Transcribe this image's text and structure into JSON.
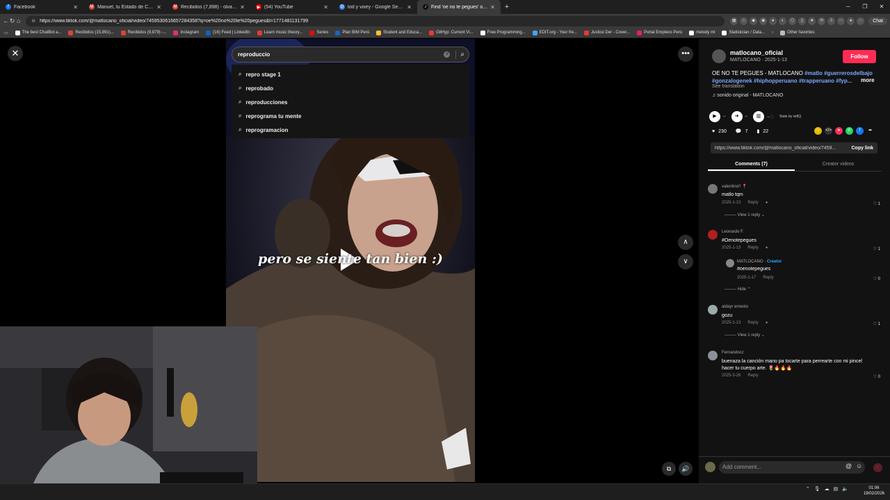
{
  "browser": {
    "tabs": [
      {
        "label": "Facebook",
        "color": "#1877f2",
        "glyph": "f"
      },
      {
        "label": "Manuel, tu Estado de Cuenta ya está",
        "color": "#db4437",
        "glyph": "M"
      },
      {
        "label": "Recibidos (7,898) - olvan.mu@gm",
        "color": "#db4437",
        "glyph": "M"
      },
      {
        "label": "(54) YouTube",
        "color": "#ff0000",
        "glyph": "▶"
      },
      {
        "label": "tod y vixey - Google Search",
        "color": "#4285f4",
        "glyph": "G"
      },
      {
        "label": "Find 'oe no te pegues' on TikTok",
        "color": "#111111",
        "glyph": "♪"
      }
    ],
    "url": "https://www.tiktok.com/@matlocano_oficial/video/7459530616657284358?q=oe%20no%20te%20pegues&t=1771481131799",
    "chat_label": "Chat",
    "bookmarks": [
      {
        "label": "The best ChatBot a...",
        "color": "#ffffff"
      },
      {
        "label": "Recibidos (15,891)...",
        "color": "#db4437"
      },
      {
        "label": "Recibidos (9,879) -...",
        "color": "#db4437"
      },
      {
        "label": "Instagram",
        "color": "#e1306c"
      },
      {
        "label": "(16) Feed | LinkedIn",
        "color": "#0a66c2"
      },
      {
        "label": "Learn music theory...",
        "color": "#e53935"
      },
      {
        "label": "Series",
        "color": "#e50914"
      },
      {
        "label": "Plan BIM Perú",
        "color": "#1565c0"
      },
      {
        "label": "Student and Educa...",
        "color": "#fbc02d"
      },
      {
        "label": "GitHyp: Current Vi...",
        "color": "#e53935"
      },
      {
        "label": "Free Programming...",
        "color": "#ffffff"
      },
      {
        "label": "EDIT.org - Your fre...",
        "color": "#42a5f5"
      },
      {
        "label": "Justice Der - Cover...",
        "color": "#e53935"
      },
      {
        "label": "Portal Empleos Perú",
        "color": "#e91e63"
      },
      {
        "label": "melody ml",
        "color": "#ffffff"
      },
      {
        "label": "Statistician / Data...",
        "color": "#ffffff"
      }
    ],
    "other_favorites": "Other favorites"
  },
  "search": {
    "query": "reproduccio",
    "suggestions": [
      "repro stage 1",
      "reprobado",
      "reproducciones",
      "reprograma tu mente",
      "reprogramacion"
    ]
  },
  "video": {
    "caption": "pero se siente tan bien :)"
  },
  "panel": {
    "username": "matlocano_oficial",
    "display_meta": "MATLOCANO · 2025-1-13",
    "follow_label": "Follow",
    "desc_text": "OE NO TE PEGUES - MATLOCANO",
    "hashtags": [
      "#matlo",
      "#guerrerosdelbajo",
      "#gonzalogenek",
      "#hiphopperuano",
      "#trapperuano",
      "#fyp..."
    ],
    "more_label": "more",
    "see_translation": "See translation",
    "sound": "sonido original - MATLOCANO",
    "stats_by": "Stats by vidIQ",
    "likes": "230",
    "comments": "7",
    "saves": "22",
    "link": "https://www.tiktok.com/@matlocano_oficial/video/7459...",
    "copy_link": "Copy link",
    "tab_comments": "Comments (7)",
    "tab_creator": "Creator videos",
    "comments_list": [
      {
        "user": "valentino!! 📍",
        "text": "matlo tqm",
        "date": "2025-1-13",
        "reply": "Reply",
        "likes": "1",
        "view": "View 1 reply"
      },
      {
        "user": "Leonardo F.",
        "text": "#Oenotepegues",
        "date": "2025-1-13",
        "reply": "Reply",
        "likes": "1"
      },
      {
        "user": "aldayr ernesto",
        "text": "gozu",
        "date": "2025-1-13",
        "reply": "Reply",
        "likes": "1",
        "view": "View 1 reply"
      },
      {
        "user": "Fernandocz",
        "text": "buenaza la canción mano pa tocarte para perrearte con mi pincel hacer tu cuerpo arte. 🌷🔥🔥🔥",
        "date": "2025-3-26",
        "reply": "Reply",
        "likes": "0"
      }
    ],
    "reply": {
      "user": "MATLOCANO",
      "creator": "Creator",
      "text": "#oenotepegues",
      "date": "2025-1-17",
      "reply": "Reply",
      "likes": "0",
      "hide": "Hide"
    },
    "add_comment": "Add comment..."
  },
  "taskbar": {
    "time": "01:06",
    "date": "19/02/2026"
  }
}
